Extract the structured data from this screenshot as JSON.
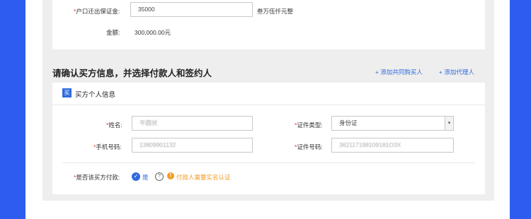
{
  "deposit": {
    "label": "户口迁出保证金:",
    "value": "35000",
    "in_words": "叁万伍仟元整",
    "amount_label": "金额:",
    "amount_value": "300,000.00元"
  },
  "buyer_section": {
    "title": "请确认买方信息，并选择付款人和签约人",
    "add_co_buyer": "+ 添加共同购买人",
    "add_agent": "+ 添加代理人"
  },
  "buyer_card": {
    "badge": "买",
    "title": "买方个人信息",
    "name_label": "姓名:",
    "name_value": "平圆状",
    "phone_label": "手机号码:",
    "phone_value": "13809901132",
    "id_type_label": "证件类型:",
    "id_type_value": "身份证",
    "id_number_label": "证件号码:",
    "id_number_value": "362117198109181O3X",
    "pay_label": "是否该买方付款:",
    "pay_yes": "是",
    "pay_warning": "付款人需要实名认证"
  },
  "colors": {
    "accent": "#2f6bdc",
    "background_blue": "#2f5cf0",
    "warning": "#f39a1e",
    "required": "#e33333"
  },
  "icons": {
    "check": "check-circle-icon",
    "help": "help-circle-icon",
    "warning": "warning-circle-icon",
    "dropdown": "chevron-down-icon"
  }
}
